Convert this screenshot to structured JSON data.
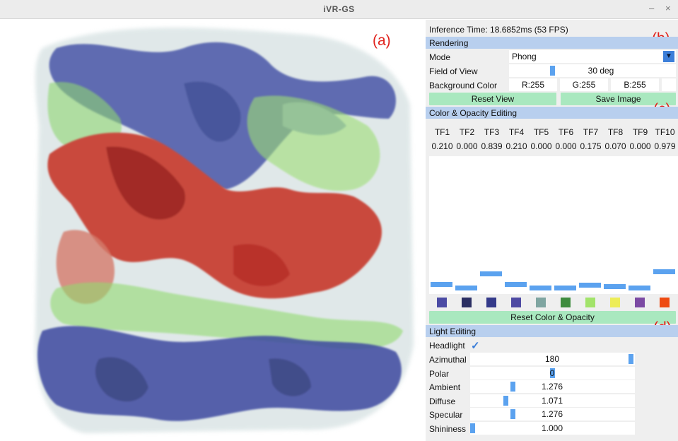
{
  "window": {
    "title": "iVR-GS",
    "minimize": "–",
    "close": "×"
  },
  "annotations": {
    "a": "(a)",
    "b": "(b)",
    "c": "(c)",
    "d": "(d)"
  },
  "panel": {
    "inference": "Inference Time:  18.6852ms (53 FPS)",
    "rendering": {
      "header": "Rendering",
      "mode_label": "Mode",
      "mode_value": "Phong",
      "fov_label": "Field of View",
      "fov_value": "30 deg",
      "bg_label": "Background Color",
      "bg_r": "R:255",
      "bg_g": "G:255",
      "bg_b": "B:255",
      "reset_view": "Reset View",
      "save_image": "Save Image"
    },
    "color_opacity": {
      "header": "Color & Opacity Editing",
      "tfs": [
        {
          "name": "TF1",
          "value": "0.210",
          "opacity": 0.21,
          "color": "#4b4ba4"
        },
        {
          "name": "TF2",
          "value": "0.000",
          "opacity": 0.0,
          "color": "#2b2f63"
        },
        {
          "name": "TF3",
          "value": "0.839",
          "opacity": 0.839,
          "color": "#343a8a"
        },
        {
          "name": "TF4",
          "value": "0.210",
          "opacity": 0.21,
          "color": "#4e4aa3"
        },
        {
          "name": "TF5",
          "value": "0.000",
          "opacity": 0.0,
          "color": "#7fa5a1"
        },
        {
          "name": "TF6",
          "value": "0.000",
          "opacity": 0.0,
          "color": "#3e8c3e"
        },
        {
          "name": "TF7",
          "value": "0.175",
          "opacity": 0.175,
          "color": "#a2e36a"
        },
        {
          "name": "TF8",
          "value": "0.070",
          "opacity": 0.07,
          "color": "#eded57"
        },
        {
          "name": "TF9",
          "value": "0.000",
          "opacity": 0.0,
          "color": "#7b4aa3"
        },
        {
          "name": "TF10",
          "value": "0.979",
          "opacity": 0.979,
          "color": "#ee4b12"
        }
      ],
      "reset_button": "Reset Color & Opacity"
    },
    "light": {
      "header": "Light Editing",
      "headlight_label": "Headlight",
      "headlight_checked": true,
      "sliders": [
        {
          "label": "Azimuthal",
          "value": "180",
          "level": 0.99
        },
        {
          "label": "Polar",
          "value": "0",
          "level": 0.5
        },
        {
          "label": "Ambient",
          "value": "1.276",
          "level": 0.25
        },
        {
          "label": "Diffuse",
          "value": "1.071",
          "level": 0.21
        },
        {
          "label": "Specular",
          "value": "1.276",
          "level": 0.25
        },
        {
          "label": "Shininess",
          "value": "1.000",
          "level": 0.0
        }
      ]
    }
  },
  "colors": {
    "section": "#b8cfee",
    "button": "#a9e8bf",
    "accent": "#5ba2ef",
    "annotation": "#e0201a"
  }
}
